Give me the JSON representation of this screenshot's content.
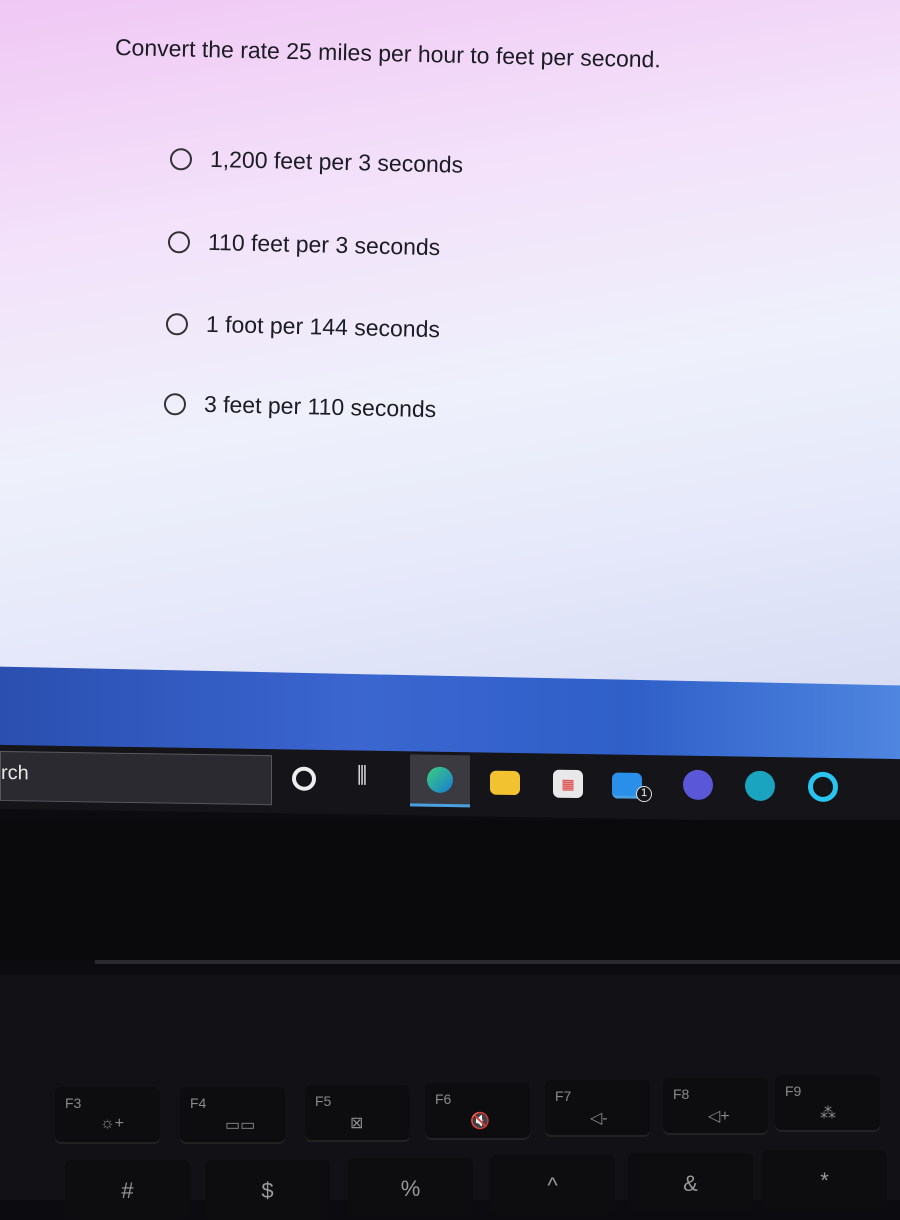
{
  "quiz": {
    "question": "Convert the rate 25 miles per hour to feet per second.",
    "options": [
      "1,200 feet per 3 seconds",
      "110 feet per 3 seconds",
      "1 foot per 144 seconds",
      "3 feet per 110 seconds"
    ]
  },
  "taskbar": {
    "search_text": "rch",
    "apps": [
      {
        "name": "cortana",
        "color": "#ffffff"
      },
      {
        "name": "task-view",
        "color": "#ffffff"
      },
      {
        "name": "edge",
        "color": "#1fa0e0",
        "active": true
      },
      {
        "name": "file-explorer",
        "color": "#f2c230"
      },
      {
        "name": "microsoft-store",
        "color": "#e8e8e8"
      },
      {
        "name": "mail",
        "color": "#2a8fe8",
        "badge": "1"
      },
      {
        "name": "app-purple",
        "color": "#5a58d8"
      },
      {
        "name": "app-search-teal",
        "color": "#1aa4c0"
      },
      {
        "name": "alexa",
        "color": "#2ac4f0"
      }
    ]
  },
  "keyboard": {
    "fkeys": [
      {
        "label": "F3",
        "icon": "☼+"
      },
      {
        "label": "F4",
        "icon": "▭▭"
      },
      {
        "label": "F5",
        "icon": "⊠"
      },
      {
        "label": "F6",
        "icon": "🔇"
      },
      {
        "label": "F7",
        "icon": "◁-"
      },
      {
        "label": "F8",
        "icon": "◁+"
      },
      {
        "label": "F9",
        "icon": "⁂"
      }
    ],
    "number_keys": [
      "#",
      "$",
      "%",
      "^",
      "&",
      "*"
    ]
  }
}
